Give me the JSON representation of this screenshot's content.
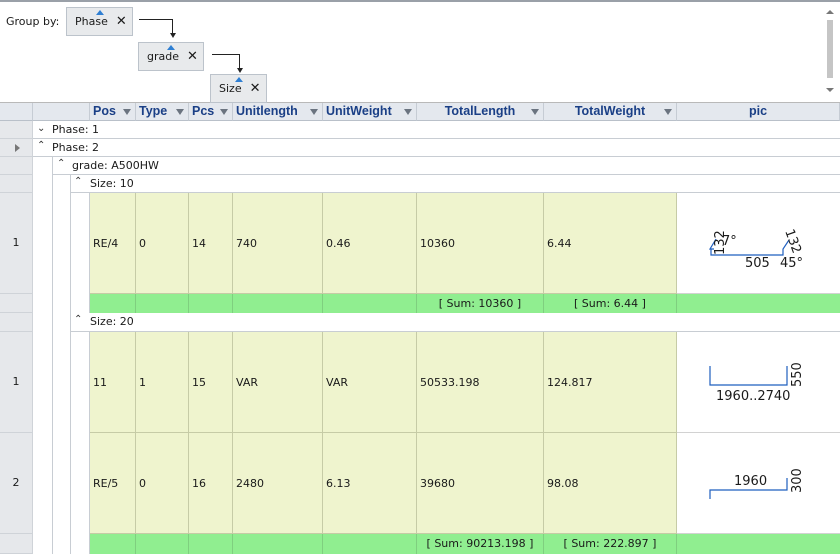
{
  "group_panel": {
    "label": "Group by:",
    "chips": [
      "Phase",
      "grade",
      "Size"
    ],
    "remove_glyph": "✕"
  },
  "columns": [
    "Pos",
    "Type",
    "Pcs",
    "Unitlength",
    "UnitWeight",
    "TotalLength",
    "TotalWeight",
    "pic"
  ],
  "groups": {
    "phase1": "Phase: 1",
    "phase2": "Phase: 2",
    "grade": "grade: A500HW",
    "size10": "Size: 10",
    "size20": "Size: 20"
  },
  "size10": {
    "rows": [
      {
        "num": "1",
        "pos": "RE/4",
        "type": "0",
        "pcs": "14",
        "unitlength": "740",
        "unitweight": "0.46",
        "totallength": "10360",
        "totalweight": "6.44",
        "pic": {
          "left": "132",
          "angle1": "7°",
          "right": "132",
          "bottom": "505",
          "angle2": "45°"
        }
      }
    ],
    "sum_length": "[ Sum: 10360 ]",
    "sum_weight": "[ Sum: 6.44 ]"
  },
  "size20": {
    "rows": [
      {
        "num": "1",
        "pos": "11",
        "type": "1",
        "pcs": "15",
        "unitlength": "VAR",
        "unitweight": "VAR",
        "totallength": "50533.198",
        "totalweight": "124.817",
        "pic": {
          "length": "1960..2740",
          "height": "550"
        }
      },
      {
        "num": "2",
        "pos": "RE/5",
        "type": "0",
        "pcs": "16",
        "unitlength": "2480",
        "unitweight": "6.13",
        "totallength": "39680",
        "totalweight": "98.08",
        "pic": {
          "length": "1960",
          "height": "300"
        }
      }
    ],
    "sum_length": "[ Sum: 90213.198 ]",
    "sum_weight": "[ Sum: 222.897 ]"
  },
  "colors": {
    "data_cell": "#eff4ce",
    "summary_row": "#90ee90",
    "header_text": "#1a3f86",
    "sort_indicator": "#2f7fd3"
  },
  "icons": [
    "remove-chip-icon",
    "filter-dropdown-icon",
    "expand-caret-icon",
    "collapse-caret-icon",
    "row-pointer-icon"
  ]
}
